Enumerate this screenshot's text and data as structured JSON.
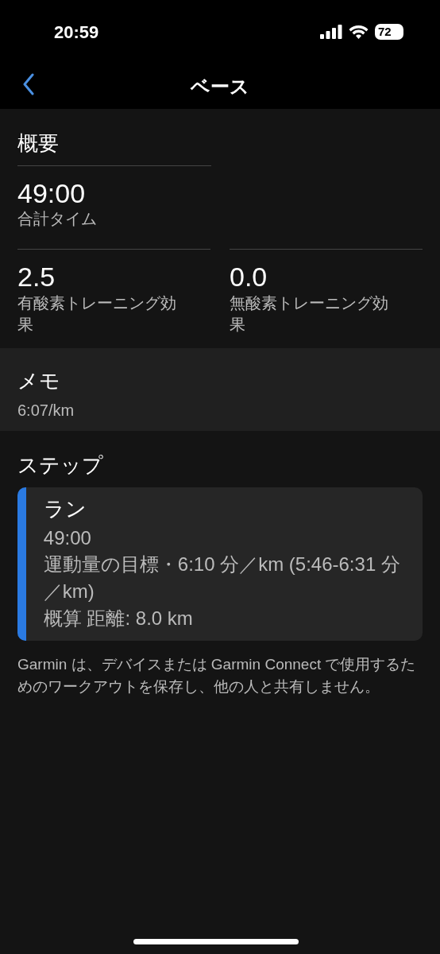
{
  "status_bar": {
    "time": "20:59",
    "battery": "72"
  },
  "nav": {
    "title": "ベース"
  },
  "summary": {
    "title": "概要",
    "total": {
      "value": "49:00",
      "label": "合計タイム"
    },
    "effects": [
      {
        "value": "2.5",
        "label": "有酸素トレーニング効果"
      },
      {
        "value": "0.0",
        "label": "無酸素トレーニング効果"
      }
    ]
  },
  "memo": {
    "title": "メモ",
    "text": "6:07/km"
  },
  "steps": {
    "title": "ステップ",
    "items": [
      {
        "name": "ラン",
        "duration": "49:00",
        "target": "運動量の目標・6:10 分／km (5:46-6:31 分／km)",
        "distance": "概算 距離: 8.0 km",
        "color": "#2a7ae2"
      }
    ]
  },
  "note": "Garmin は、デバイスまたは Garmin Connect で使用するためのワークアウトを保存し、他の人と共有しません。"
}
